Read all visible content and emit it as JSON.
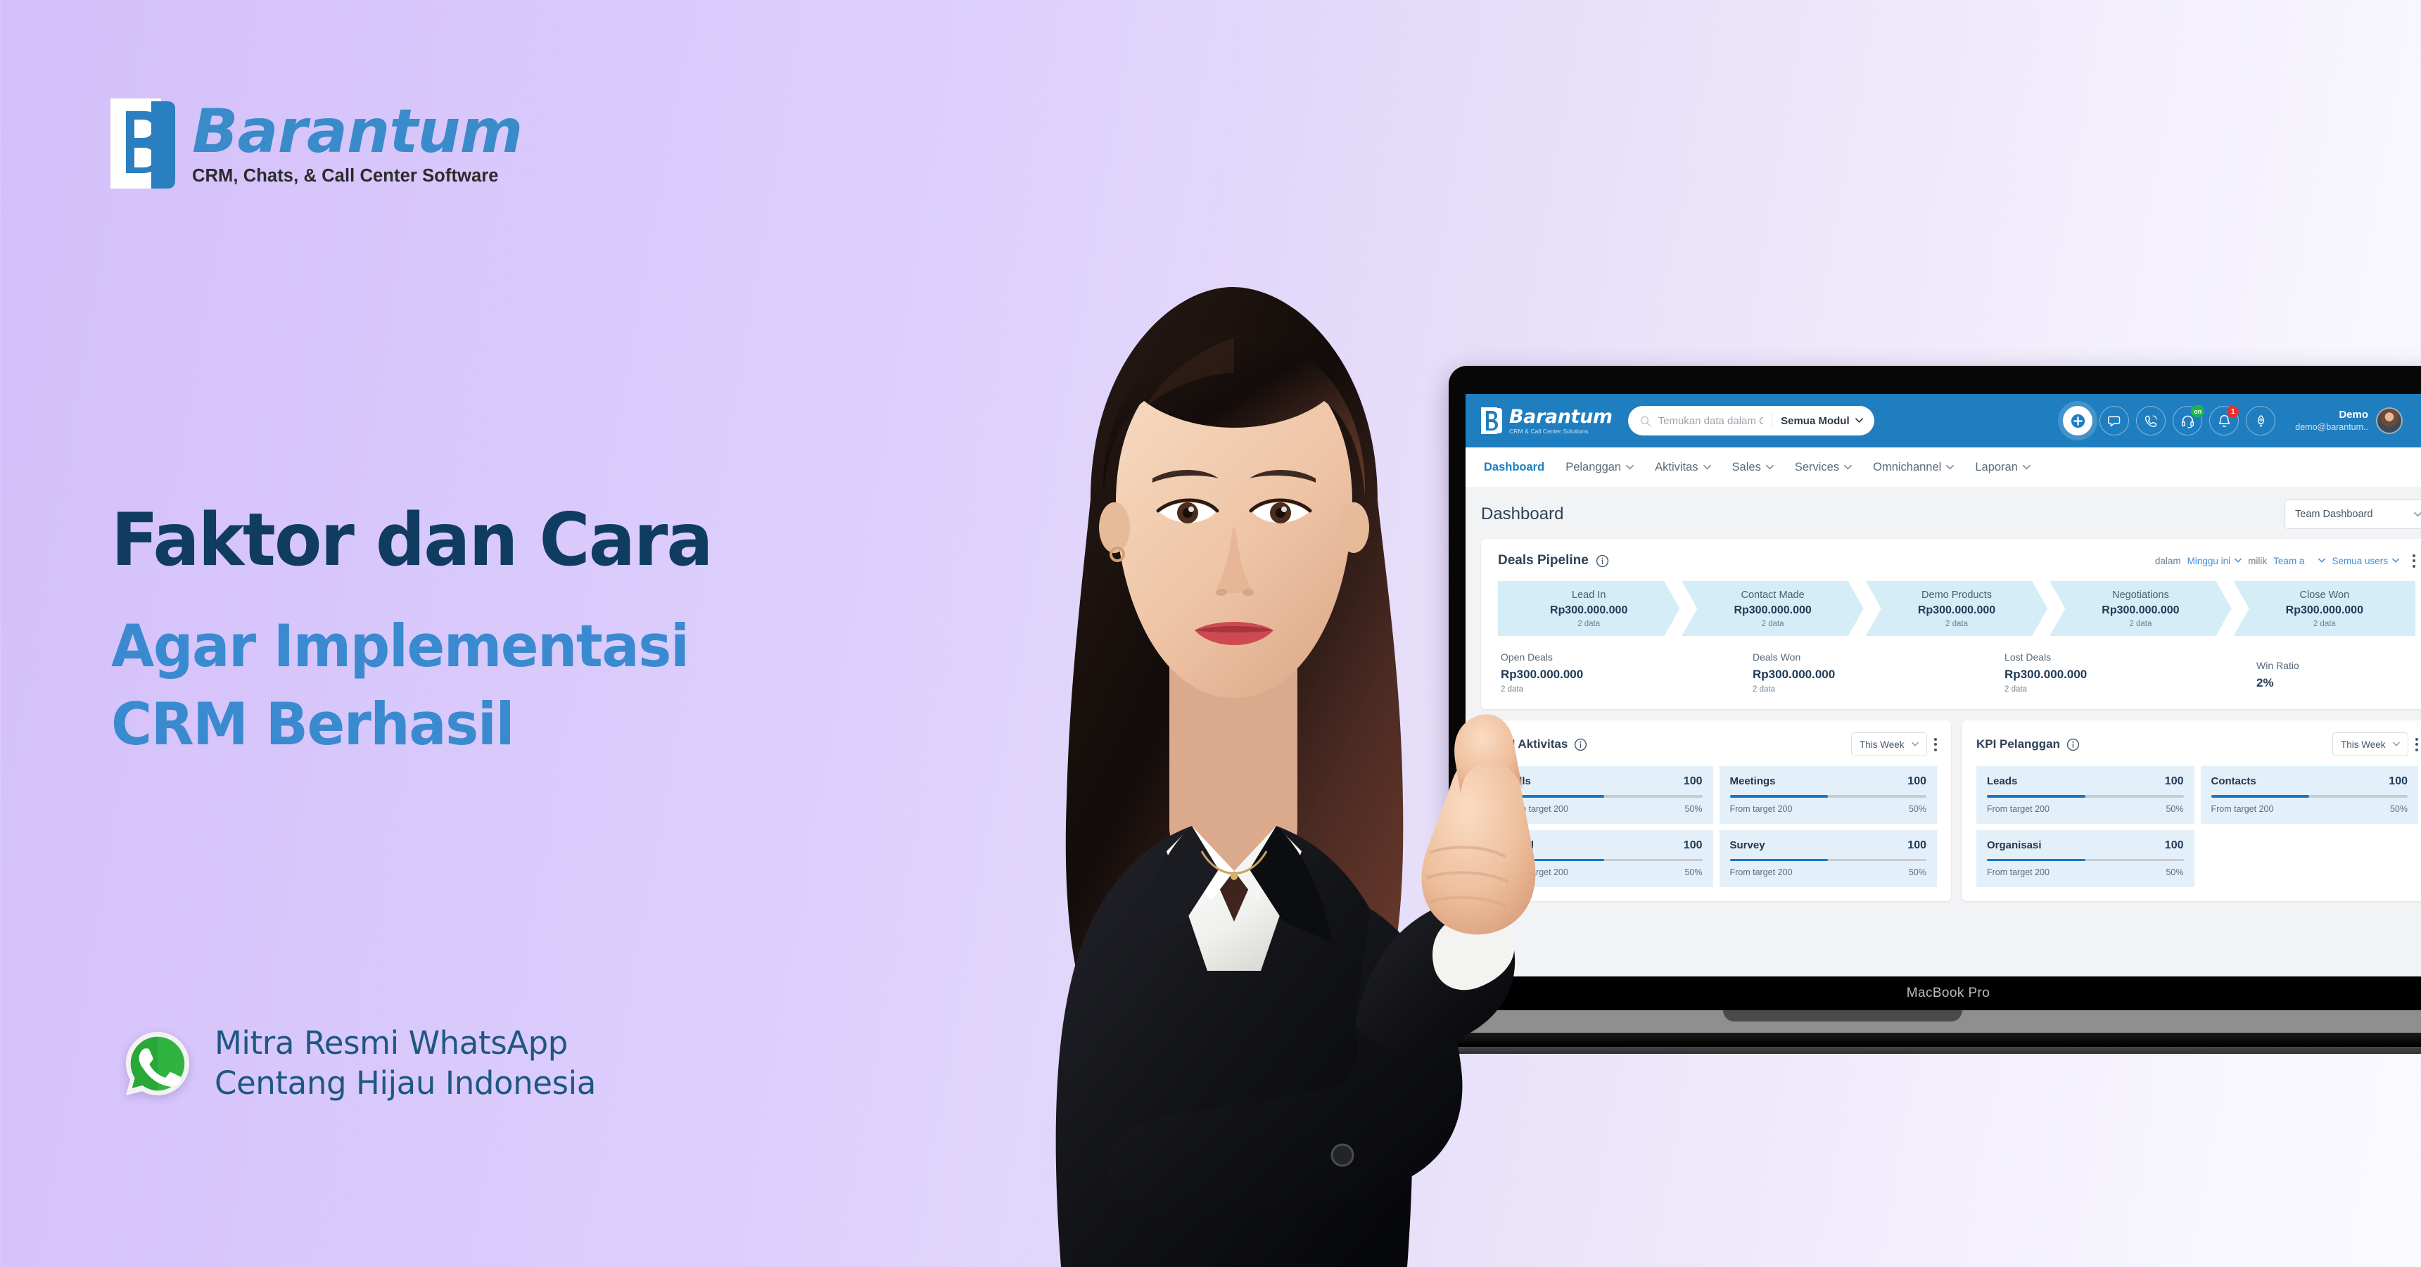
{
  "brand": {
    "logo_word": "Barantum",
    "logo_tagline": "CRM, Chats, & Call Center Software",
    "accent_blue": "#3a8bc9",
    "deep_blue": "#103c62",
    "mark_blue": "#2a7fc1"
  },
  "headline": {
    "line1": "Faktor dan Cara",
    "line2": "Agar Implementasi",
    "line3": "CRM Berhasil"
  },
  "whatsapp_badge": {
    "icon": "whatsapp-icon",
    "line1": "Mitra Resmi WhatsApp",
    "line2": "Centang Hijau Indonesia",
    "icon_color": "#25b843"
  },
  "device": {
    "model_label": "MacBook Pro"
  },
  "crm": {
    "navbar": {
      "logo_word": "Barantum",
      "logo_sub": "CRM & Call Center Solutions",
      "search_placeholder": "Temukan data dalam CRM...",
      "search_value": "",
      "module_filter": "Semua Modul",
      "icons": [
        {
          "name": "plus-icon",
          "badge": ""
        },
        {
          "name": "chat-icon",
          "badge": ""
        },
        {
          "name": "phone-icon",
          "badge": ""
        },
        {
          "name": "headset-icon",
          "badge": "on"
        },
        {
          "name": "bell-icon",
          "badge": "1"
        },
        {
          "name": "rocket-icon",
          "badge": ""
        }
      ],
      "user_name": "Demo",
      "user_email": "demo@barantum..",
      "gear": "gear-icon",
      "bar_color": "#1f7ec0"
    },
    "menu": [
      {
        "label": "Dashboard",
        "has_caret": false,
        "active": true
      },
      {
        "label": "Pelanggan",
        "has_caret": true,
        "active": false
      },
      {
        "label": "Aktivitas",
        "has_caret": true,
        "active": false
      },
      {
        "label": "Sales",
        "has_caret": true,
        "active": false
      },
      {
        "label": "Services",
        "has_caret": true,
        "active": false
      },
      {
        "label": "Omnichannel",
        "has_caret": true,
        "active": false
      },
      {
        "label": "Laporan",
        "has_caret": true,
        "active": false
      }
    ],
    "page": {
      "title": "Dashboard",
      "dashboard_selector": "Team Dashboard"
    },
    "deals_pipeline": {
      "title": "Deals Pipeline",
      "filter_prefix": "dalam",
      "filter_period": "Minggu ini",
      "filter_owner_prefix": "milik",
      "filter_team": "Team a",
      "filter_users": "Semua users",
      "stages": [
        {
          "name": "Lead In",
          "value": "Rp300.000.000",
          "count": "2 data"
        },
        {
          "name": "Contact Made",
          "value": "Rp300.000.000",
          "count": "2 data"
        },
        {
          "name": "Demo Products",
          "value": "Rp300.000.000",
          "count": "2 data"
        },
        {
          "name": "Negotiations",
          "value": "Rp300.000.000",
          "count": "2 data"
        },
        {
          "name": "Close Won",
          "value": "Rp300.000.000",
          "count": "2 data"
        }
      ],
      "metrics": [
        {
          "name": "Open Deals",
          "value": "Rp300.000.000",
          "count": "2 data"
        },
        {
          "name": "Deals Won",
          "value": "Rp300.000.000",
          "count": "2 data"
        },
        {
          "name": "Lost Deals",
          "value": "Rp300.000.000",
          "count": "2 data"
        },
        {
          "name": "Win Ratio",
          "value": "2%",
          "count": ""
        }
      ]
    },
    "kpi_aktivitas": {
      "title": "KPI Aktivitas",
      "period": "This Week",
      "items": [
        {
          "label": "Calls",
          "value": "100",
          "target": "From target 200",
          "pct": "50%",
          "fill": 50
        },
        {
          "label": "Meetings",
          "value": "100",
          "target": "From target 200",
          "pct": "50%",
          "fill": 50
        },
        {
          "label": "Email",
          "value": "100",
          "target": "From target 200",
          "pct": "50%",
          "fill": 50
        },
        {
          "label": "Survey",
          "value": "100",
          "target": "From target 200",
          "pct": "50%",
          "fill": 50
        }
      ]
    },
    "kpi_pelanggan": {
      "title": "KPI Pelanggan",
      "period": "This Week",
      "items": [
        {
          "label": "Leads",
          "value": "100",
          "target": "From target 200",
          "pct": "50%",
          "fill": 50
        },
        {
          "label": "Contacts",
          "value": "100",
          "target": "From target 200",
          "pct": "50%",
          "fill": 50
        },
        {
          "label": "Organisasi",
          "value": "100",
          "target": "From target 200",
          "pct": "50%",
          "fill": 50
        }
      ]
    }
  }
}
